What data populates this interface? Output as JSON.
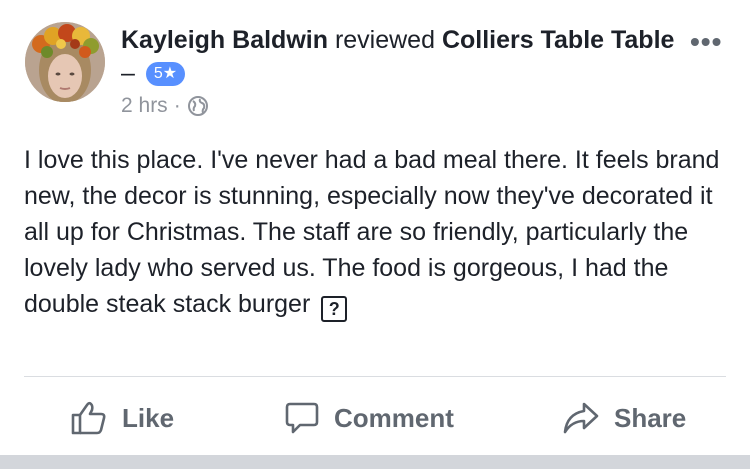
{
  "post": {
    "author": "Kayleigh Baldwin",
    "action_text": "reviewed",
    "business": "Colliers Table Table",
    "dash": "–",
    "rating": "5★",
    "time": "2 hrs",
    "separator": "·",
    "privacy_icon": "globe-icon",
    "body": "I love this place. I've never had a bad meal there. It feels brand new, the decor is stunning, especially now they've decorated it all up for Christmas. The staff are so friendly, particularly the lovely lady who served us. The food is gorgeous, I had the double steak stack burger",
    "unknown_char": "?"
  },
  "more_button": "•••",
  "actions": {
    "like_label": "Like",
    "comment_label": "Comment",
    "share_label": "Share"
  },
  "colors": {
    "text": "#1d2129",
    "secondary": "#90949c",
    "action": "#606770",
    "badge": "#5890ff",
    "divider": "#dadde1"
  }
}
